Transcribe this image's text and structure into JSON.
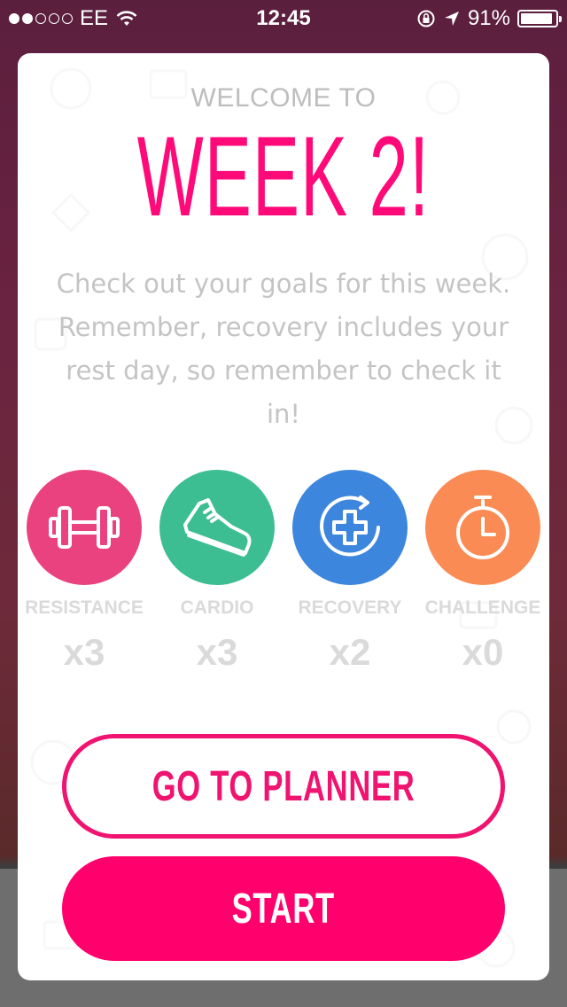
{
  "status_bar": {
    "carrier": "EE",
    "time": "12:45",
    "battery_percent": "91%",
    "signal_filled": 2,
    "signal_total": 5,
    "battery_level": 0.91
  },
  "modal": {
    "eyebrow": "WELCOME TO",
    "headline": "WEEK 2!",
    "description": "Check out your goals for this week. Remember, recovery includes your rest day, so remember to check it in!",
    "goals": [
      {
        "label": "RESISTANCE",
        "count": "x3",
        "color": "#e9427f",
        "icon": "dumbbell-icon"
      },
      {
        "label": "CARDIO",
        "count": "x3",
        "color": "#3dbe92",
        "icon": "sneaker-icon"
      },
      {
        "label": "RECOVERY",
        "count": "x2",
        "color": "#3d86dd",
        "icon": "recovery-cross-icon"
      },
      {
        "label": "CHALLENGE",
        "count": "x0",
        "color": "#fb8b55",
        "icon": "stopwatch-icon"
      }
    ],
    "planner_button": "GO TO PLANNER",
    "start_button": "START"
  },
  "colors": {
    "accent": "#ff0a78",
    "label_gray": "#dadada"
  }
}
